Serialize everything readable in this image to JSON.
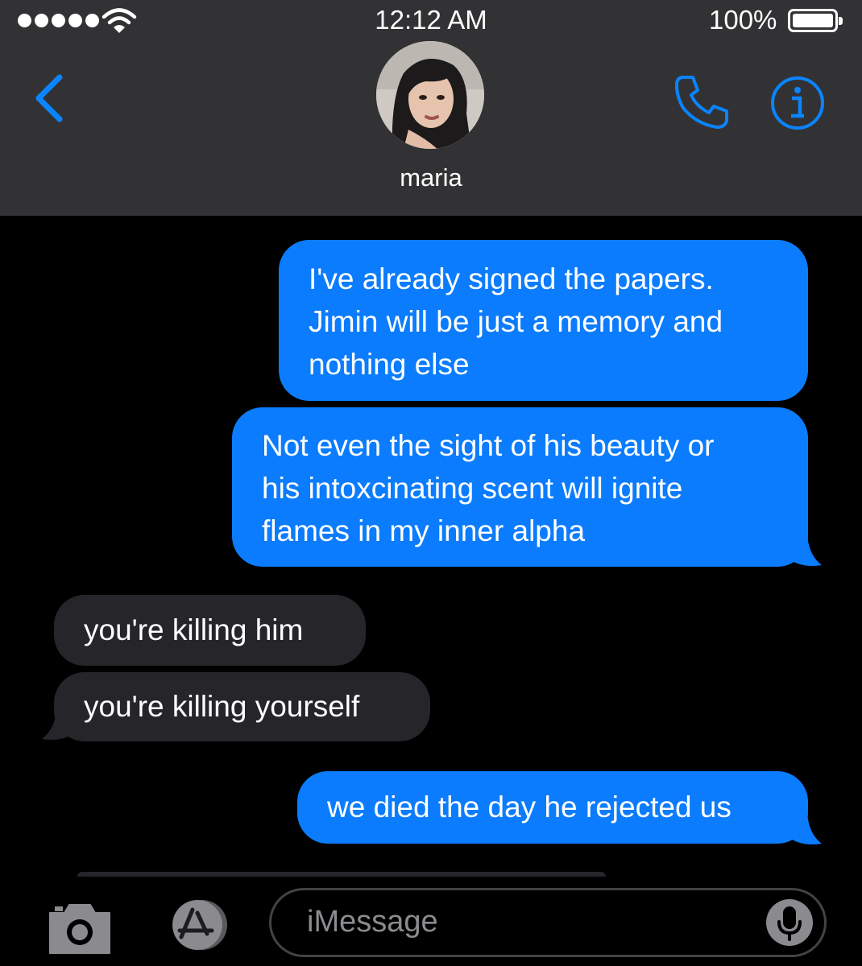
{
  "status_bar": {
    "time": "12:12 AM",
    "battery_percent": "100%",
    "signal_icon": "signal-dots-icon",
    "wifi_icon": "wifi-icon"
  },
  "header": {
    "contact_name": "maria",
    "back_icon": "chevron-left-icon",
    "call_icon": "phone-icon",
    "info_icon": "info-icon"
  },
  "messages": [
    {
      "direction": "outgoing",
      "lines": [
        "I've already signed the papers.",
        "Jimin will be just a memory and",
        "nothing else"
      ]
    },
    {
      "direction": "outgoing",
      "lines": [
        "Not even the sight of his beauty or",
        "his intoxcinating scent will ignite",
        "flames in my inner alpha"
      ]
    },
    {
      "direction": "incoming",
      "lines": [
        "you're killing him"
      ]
    },
    {
      "direction": "incoming",
      "lines": [
        "you're killing yourself"
      ]
    },
    {
      "direction": "outgoing",
      "lines": [
        "we died the day he rejected us"
      ]
    }
  ],
  "composer": {
    "placeholder": "iMessage",
    "camera_icon": "camera-icon",
    "apps_icon": "app-store-icon",
    "mic_icon": "microphone-icon"
  },
  "colors": {
    "outgoing_bubble": "#0b7cfd",
    "incoming_bubble": "#262529",
    "accent": "#0a84ff",
    "header_bg": "#323234"
  }
}
